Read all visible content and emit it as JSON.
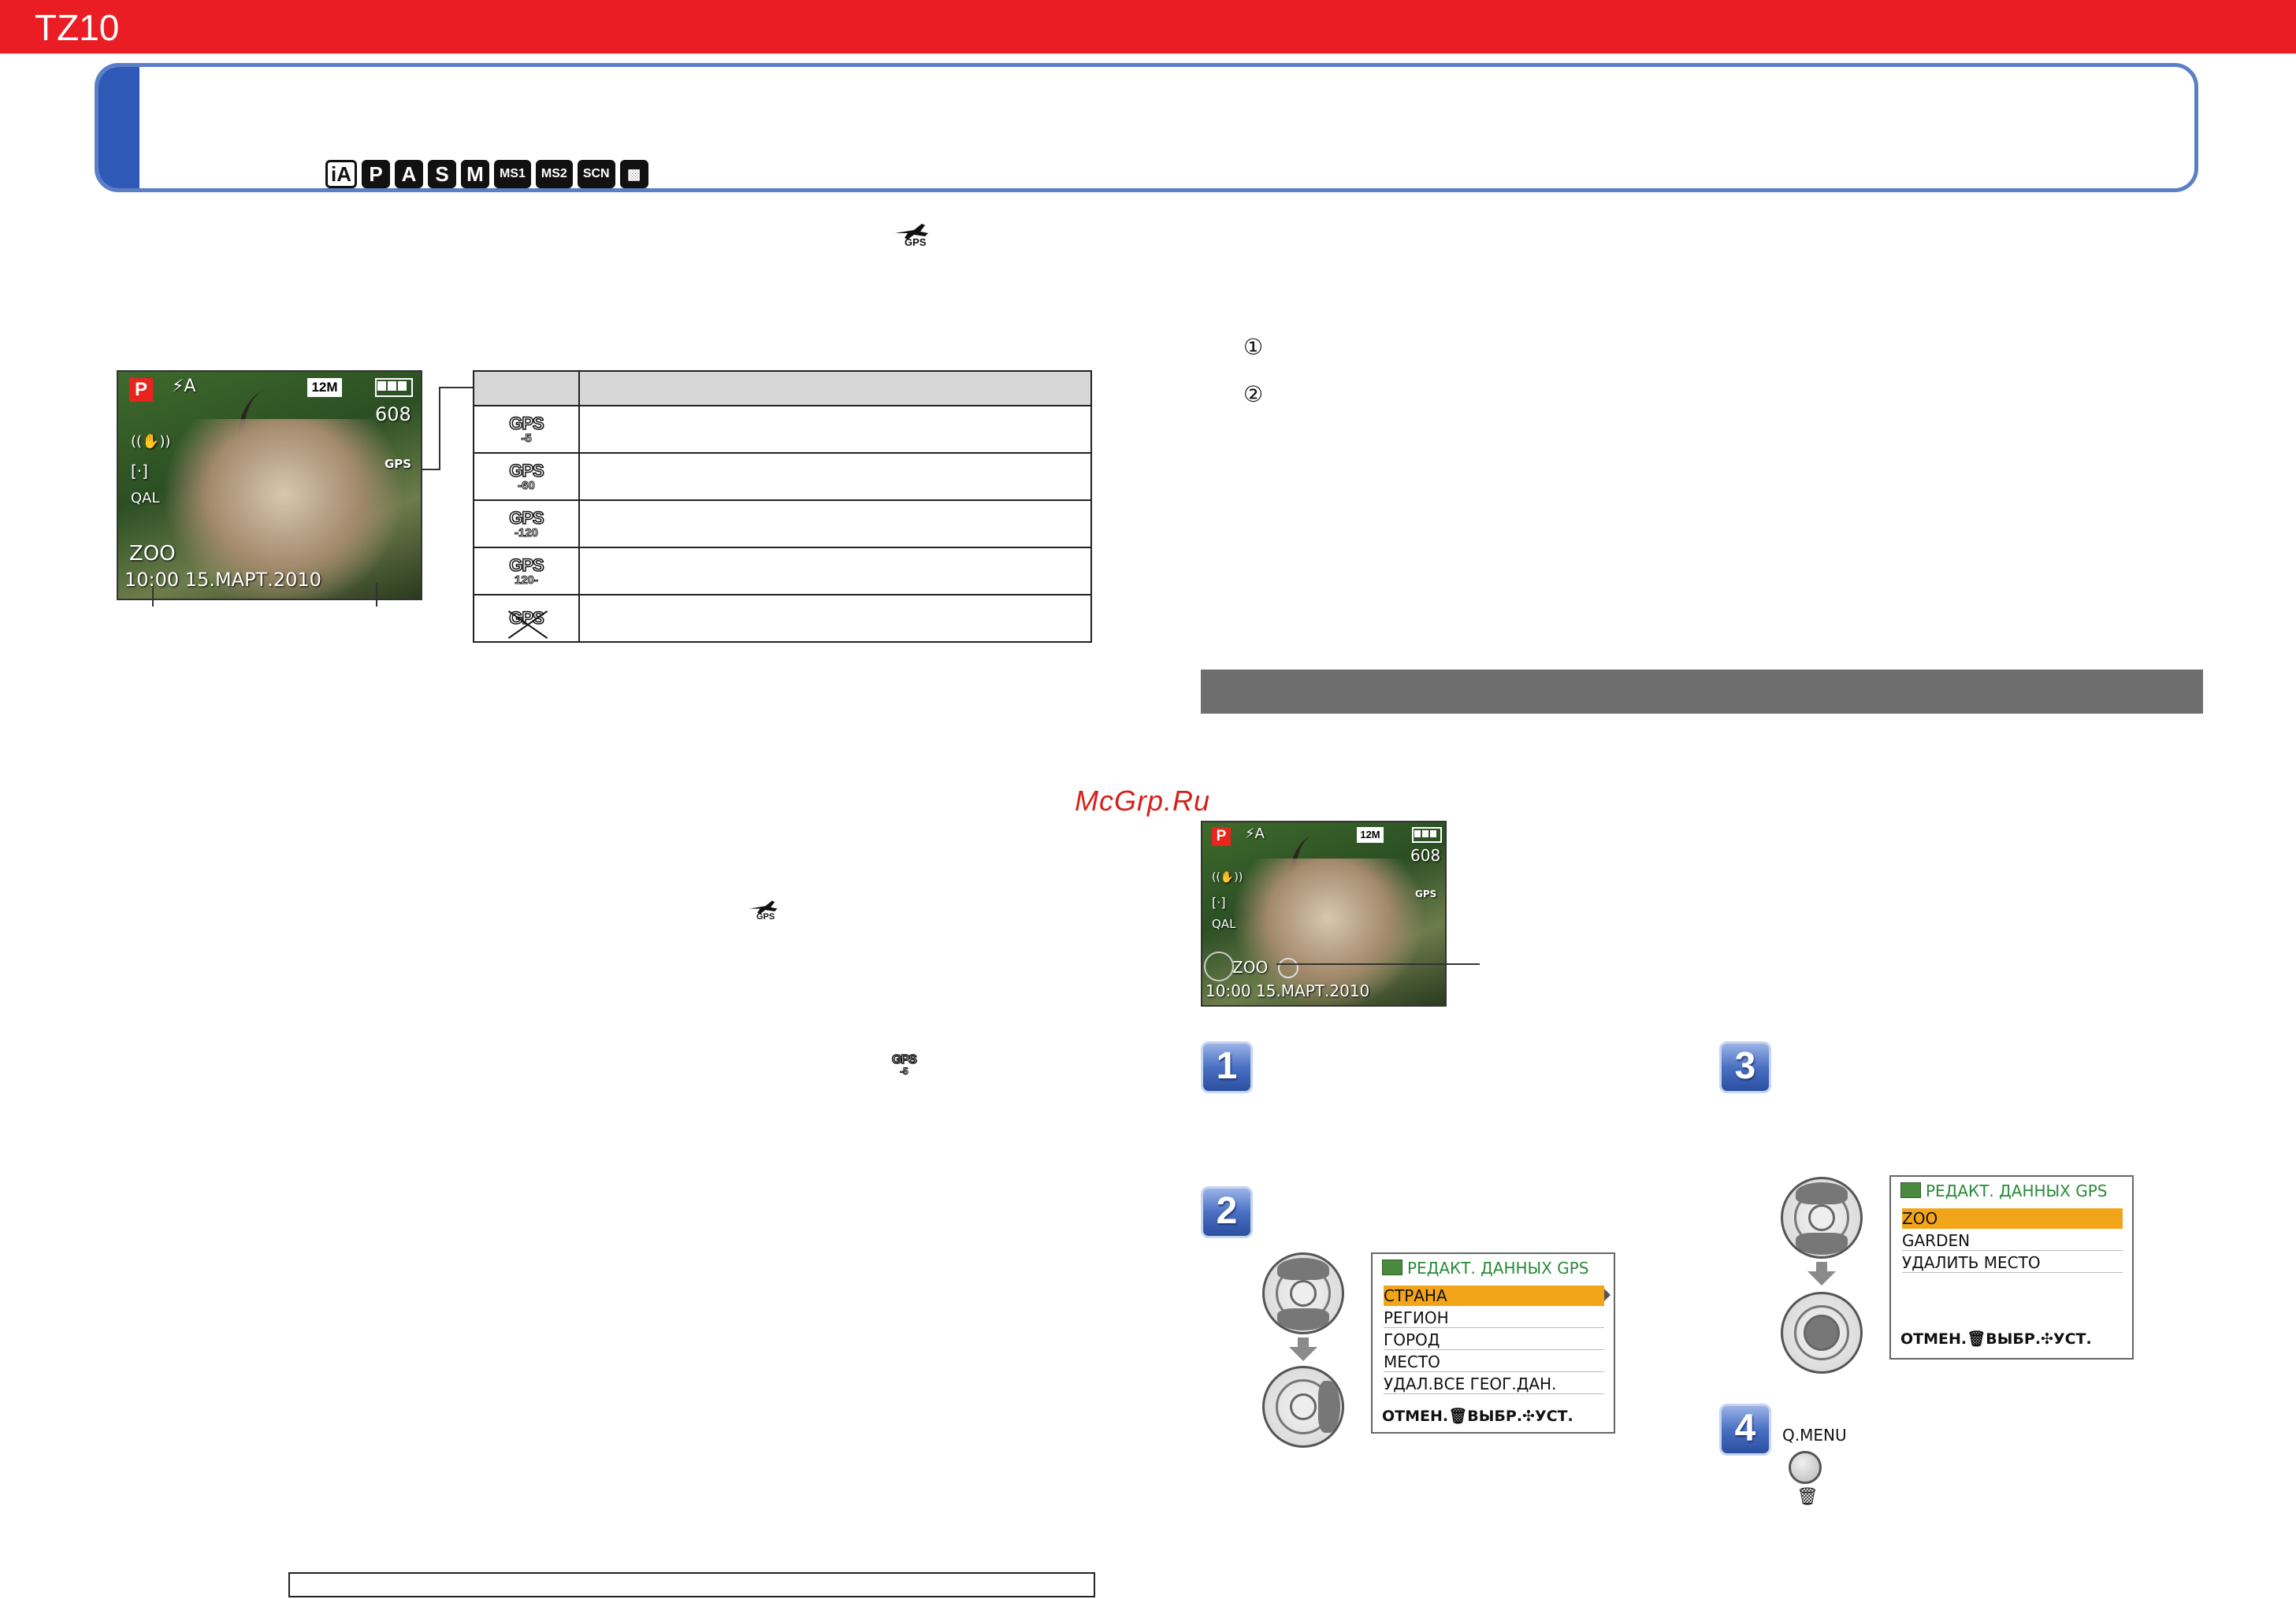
{
  "topbar": {
    "title": "TZ10"
  },
  "header": {
    "modes": [
      "iA",
      "P",
      "A",
      "S",
      "M",
      "MS1",
      "MS2",
      "SCN",
      "▩"
    ]
  },
  "body_icons": {
    "airplane_gps": "GPS",
    "gps_small": "GPS",
    "gps_small_sub": "-5"
  },
  "callouts": {
    "c1": "①",
    "c2": "②"
  },
  "camera1": {
    "mode": "P",
    "flash": "⚡A",
    "size": "12M",
    "count": "608",
    "gps": "GPS",
    "place": "ZOO",
    "datetime": "10:00 15.МАРТ.2010",
    "qal": "QAL"
  },
  "gps_table": {
    "rows": [
      {
        "icon_top": "GPS",
        "icon_sub": "-5"
      },
      {
        "icon_top": "GPS",
        "icon_sub": "-60"
      },
      {
        "icon_top": "GPS",
        "icon_sub": "-120"
      },
      {
        "icon_top": "GPS",
        "icon_sub": "120-"
      },
      {
        "icon_top": "GPS",
        "icon_sub": ""
      }
    ]
  },
  "watermark": "McGrp.Ru",
  "camera2": {
    "mode": "P",
    "flash": "⚡A",
    "size": "12M",
    "count": "608",
    "gps": "GPS",
    "place": "ZOO",
    "datetime": "10:00 15.МАРТ.2010",
    "qal": "QAL"
  },
  "steps": {
    "s1": "1",
    "s2": "2",
    "s3": "3",
    "s4": "4"
  },
  "menu1": {
    "title": "РЕДАКТ. ДАННЫХ GPS",
    "items": [
      "СТРАНА",
      "РЕГИОН",
      "ГОРОД",
      "МЕСТО",
      "УДАЛ.ВСЕ ГЕОГ.ДАН."
    ],
    "footer": "ОТМЕН.🗑ВЫБР.✣УСТ."
  },
  "menu2": {
    "title": "РЕДАКТ. ДАННЫХ GPS",
    "items": [
      "ZOO",
      "GARDEN",
      "УДАЛИТЬ МЕСТО"
    ],
    "footer": "ОТМЕН.🗑ВЫБР.✣УСТ."
  },
  "qmenu": {
    "label": "Q.MENU",
    "trash": "🗑"
  },
  "colors": {
    "brand_red": "#ea1c24",
    "header_blue": "#2f59b6",
    "highlight": "#f3a51a"
  }
}
